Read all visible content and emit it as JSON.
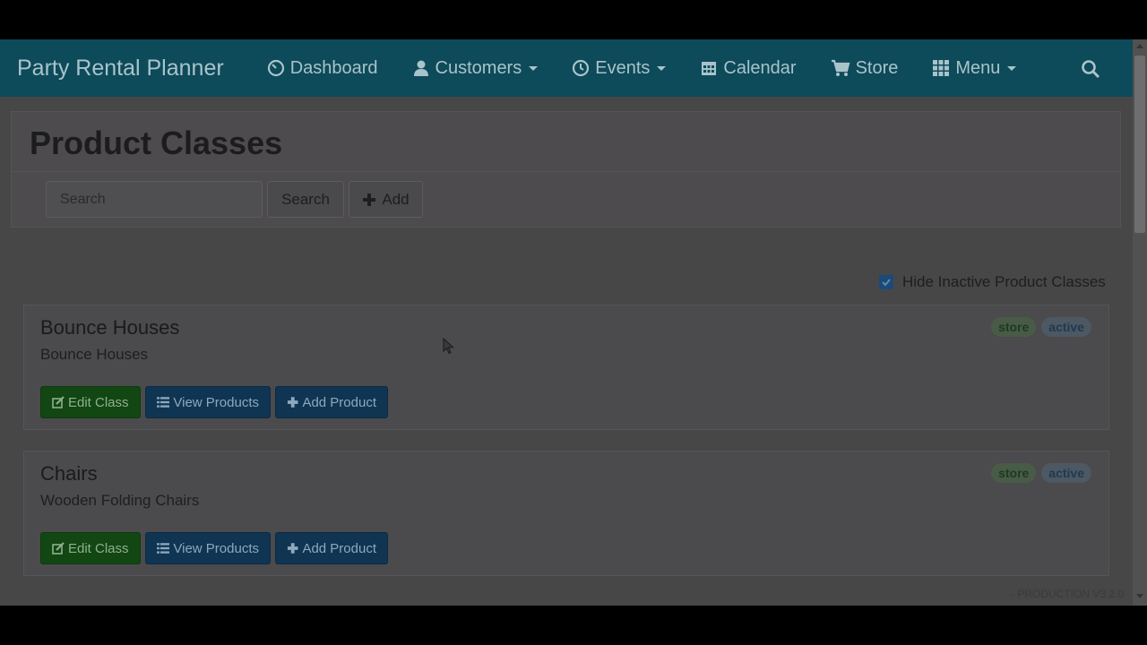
{
  "navbar": {
    "brand": "Party Rental Planner",
    "items": [
      {
        "label": "Dashboard",
        "icon": "dashboard-icon",
        "has_caret": false
      },
      {
        "label": "Customers",
        "icon": "user-icon",
        "has_caret": true
      },
      {
        "label": "Events",
        "icon": "clock-icon",
        "has_caret": true
      },
      {
        "label": "Calendar",
        "icon": "calendar-icon",
        "has_caret": false
      },
      {
        "label": "Store",
        "icon": "cart-icon",
        "has_caret": false
      },
      {
        "label": "Menu",
        "icon": "grid-icon",
        "has_caret": true
      }
    ],
    "search_icon": "search-icon"
  },
  "header": {
    "title": "Product Classes",
    "search": {
      "placeholder": "Search",
      "value": ""
    },
    "search_button": "Search",
    "add_button": "Add"
  },
  "filter": {
    "hide_inactive_label": "Hide Inactive Product Classes",
    "hide_inactive_checked": true
  },
  "classes": [
    {
      "name": "Bounce Houses",
      "description": "Bounce Houses",
      "badges": [
        "store",
        "active"
      ],
      "actions": {
        "edit": "Edit Class",
        "view": "View Products",
        "add": "Add Product"
      }
    },
    {
      "name": "Chairs",
      "description": "Wooden Folding Chairs",
      "badges": [
        "store",
        "active"
      ],
      "actions": {
        "edit": "Edit Class",
        "view": "View Products",
        "add": "Add Product"
      }
    }
  ],
  "footer": {
    "version": "- PRODUCTION V3.2.0"
  },
  "colors": {
    "navbar": "#0d4a5a",
    "success": "#124612",
    "primary": "#0f3552",
    "overlay_dim": "#474748"
  }
}
